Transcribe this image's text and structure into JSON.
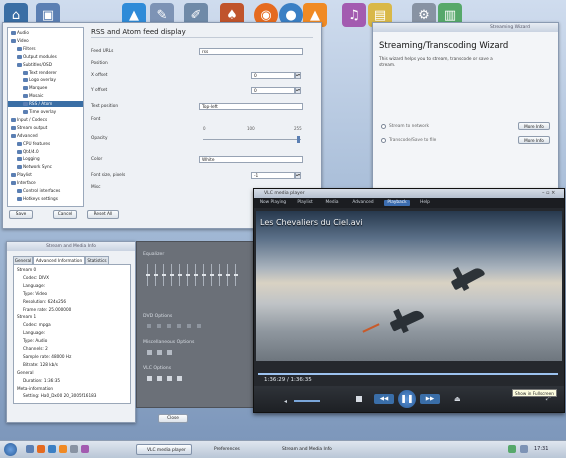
{
  "prefs": {
    "title": "RSS and Atom feed display",
    "tree": [
      {
        "label": "Audio",
        "depth": 0
      },
      {
        "label": "Video",
        "depth": 0
      },
      {
        "label": "Filters",
        "depth": 1
      },
      {
        "label": "Output modules",
        "depth": 1
      },
      {
        "label": "Subtitles/OSD",
        "depth": 1
      },
      {
        "label": "Text renderer",
        "depth": 2
      },
      {
        "label": "Logo overlay",
        "depth": 2
      },
      {
        "label": "Marquee",
        "depth": 2
      },
      {
        "label": "Mosaic",
        "depth": 2
      },
      {
        "label": "RSS / Atom",
        "depth": 2,
        "selected": true
      },
      {
        "label": "Time overlay",
        "depth": 2
      },
      {
        "label": "Input / Codecs",
        "depth": 0
      },
      {
        "label": "Stream output",
        "depth": 0
      },
      {
        "label": "Advanced",
        "depth": 0
      },
      {
        "label": "CPU features",
        "depth": 1
      },
      {
        "label": "Qt4/4.0",
        "depth": 1
      },
      {
        "label": "Logging",
        "depth": 1
      },
      {
        "label": "Network Sync",
        "depth": 1
      },
      {
        "label": "Playlist",
        "depth": 0
      },
      {
        "label": "Interface",
        "depth": 0
      },
      {
        "label": "Control interfaces",
        "depth": 1
      },
      {
        "label": "Hotkeys settings",
        "depth": 1
      }
    ],
    "feed_urls_label": "Feed URLs",
    "feed_urls_value": "rss",
    "position_label": "Position",
    "xoffset_label": "X offset",
    "xoffset_value": "0",
    "yoffset_label": "Y offset",
    "yoffset_value": "0",
    "text_position_label": "Text position",
    "text_position_value": "Top-left",
    "font_label": "Font",
    "opacity_label": "Opacity",
    "opacity_ticks": [
      "0",
      "100",
      "255"
    ],
    "color_label": "Color",
    "color_value": "White",
    "font_size_label": "Font size, pixels",
    "font_size_value": "-1",
    "misc_label": "Misc",
    "save_label": "Save",
    "cancel_label": "Cancel",
    "reset_label": "Reset All"
  },
  "wizard": {
    "window_title": "Streaming Wizard",
    "heading": "Streaming/Transcoding Wizard",
    "description": "This wizard helps you to stream, transcode or save a stream.",
    "option1": "Stream to network",
    "option2": "Transcode/Save to file",
    "more_info": "More Info"
  },
  "info": {
    "window_title": "Stream and Media Info",
    "tabs": [
      "General",
      "Advanced Information",
      "Statistics"
    ],
    "lines": [
      {
        "text": "Stream 0",
        "indent": 0
      },
      {
        "text": "Codec: DIVX",
        "indent": 2
      },
      {
        "text": "Language:",
        "indent": 2
      },
      {
        "text": "Type: Video",
        "indent": 2
      },
      {
        "text": "Resolution: 624x256",
        "indent": 2
      },
      {
        "text": "Frame rate: 25.000000",
        "indent": 2
      },
      {
        "text": "Stream 1",
        "indent": 0
      },
      {
        "text": "Codec: mpga",
        "indent": 2
      },
      {
        "text": "Language:",
        "indent": 2
      },
      {
        "text": "Type: Audio",
        "indent": 2
      },
      {
        "text": "Channels: 2",
        "indent": 2
      },
      {
        "text": "Sample rate: 48000 Hz",
        "indent": 2
      },
      {
        "text": "Bitrate: 128 kb/s",
        "indent": 2
      },
      {
        "text": "General",
        "indent": 0
      },
      {
        "text": "Duration: 1:36:35",
        "indent": 2
      },
      {
        "text": "Meta-information",
        "indent": 0
      },
      {
        "text": "Setting: Ha0_Dx00 20_3005f16183",
        "indent": 2
      }
    ],
    "close_label": "Close"
  },
  "ext": {
    "equalizer_label": "Equalizer",
    "dvd_label": "DVD Options",
    "misc_label": "Miscellaneous Options",
    "vlc_label": "VLC Options"
  },
  "player": {
    "window_title": "VLC media player",
    "menu": [
      "Now Playing",
      "Playlist",
      "Media",
      "Advanced",
      "Playback",
      "Help"
    ],
    "active_menu_index": 4,
    "video_title": "Les Chevaliers du Ciel.avi",
    "time_text": "1:36:29 / 1:36:35",
    "progress": 0.999,
    "tooltip": "Show in Fullscreen"
  },
  "taskbar": {
    "tasks": [
      {
        "label": "VLC media player",
        "active": true
      },
      {
        "label": "Preferences",
        "active": false
      },
      {
        "label": "Stream and Media Info",
        "active": false
      }
    ],
    "clock": "17:31"
  },
  "colors": {
    "accent": "#3a6ea5",
    "player_bg": "#25282d",
    "desktop": "#a9bfd9"
  }
}
